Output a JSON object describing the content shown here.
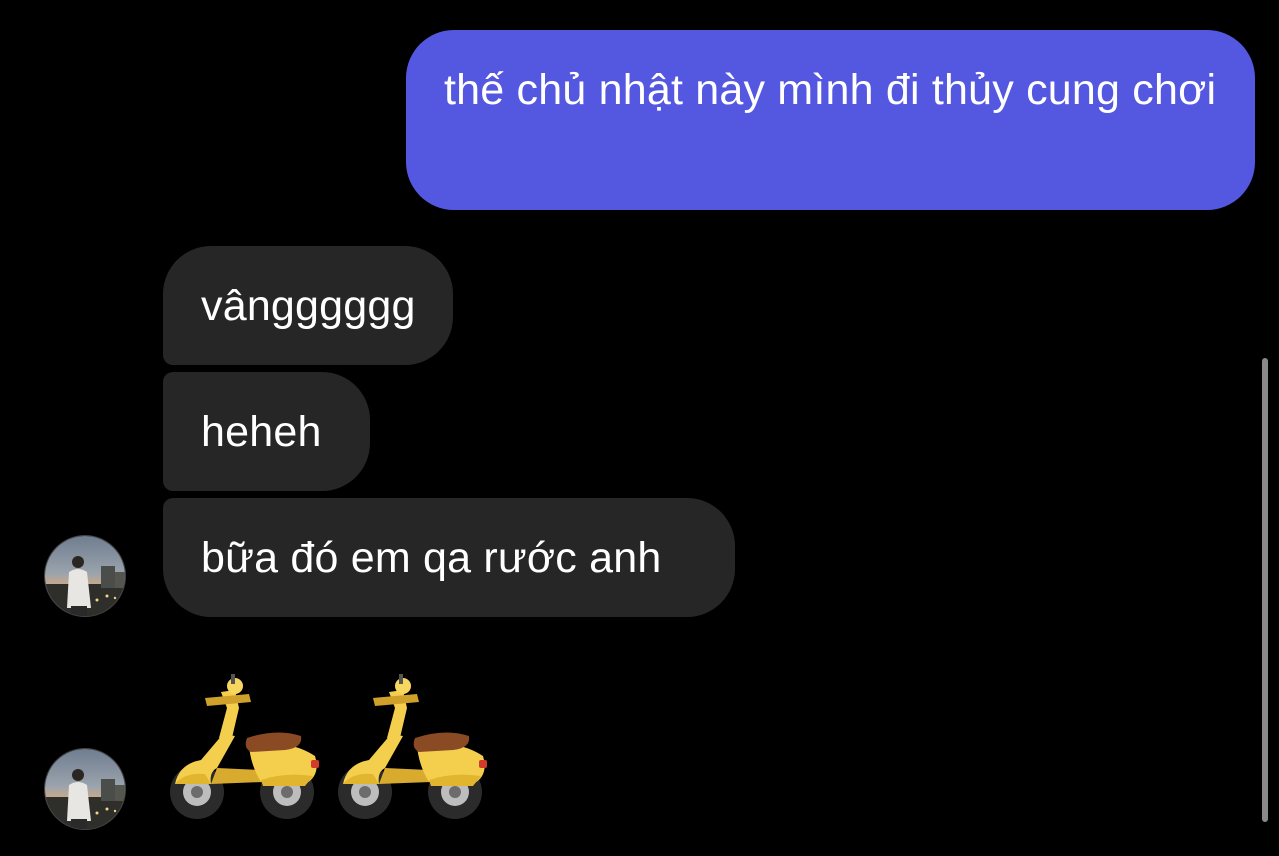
{
  "conversation": {
    "messages": [
      {
        "direction": "outgoing",
        "text": "thế chủ nhật này mình đi thủy cung chơi"
      },
      {
        "direction": "incoming",
        "text": "vângggggg"
      },
      {
        "direction": "incoming",
        "text": "heheh"
      },
      {
        "direction": "incoming",
        "text": "bữa đó em qa rước anh"
      }
    ],
    "sticker": {
      "icon": "scooter-emoji",
      "count": 2
    }
  },
  "colors": {
    "background": "#000000",
    "outgoing_bubble": "#5458e0",
    "incoming_bubble": "#262626",
    "text": "#ffffff"
  }
}
